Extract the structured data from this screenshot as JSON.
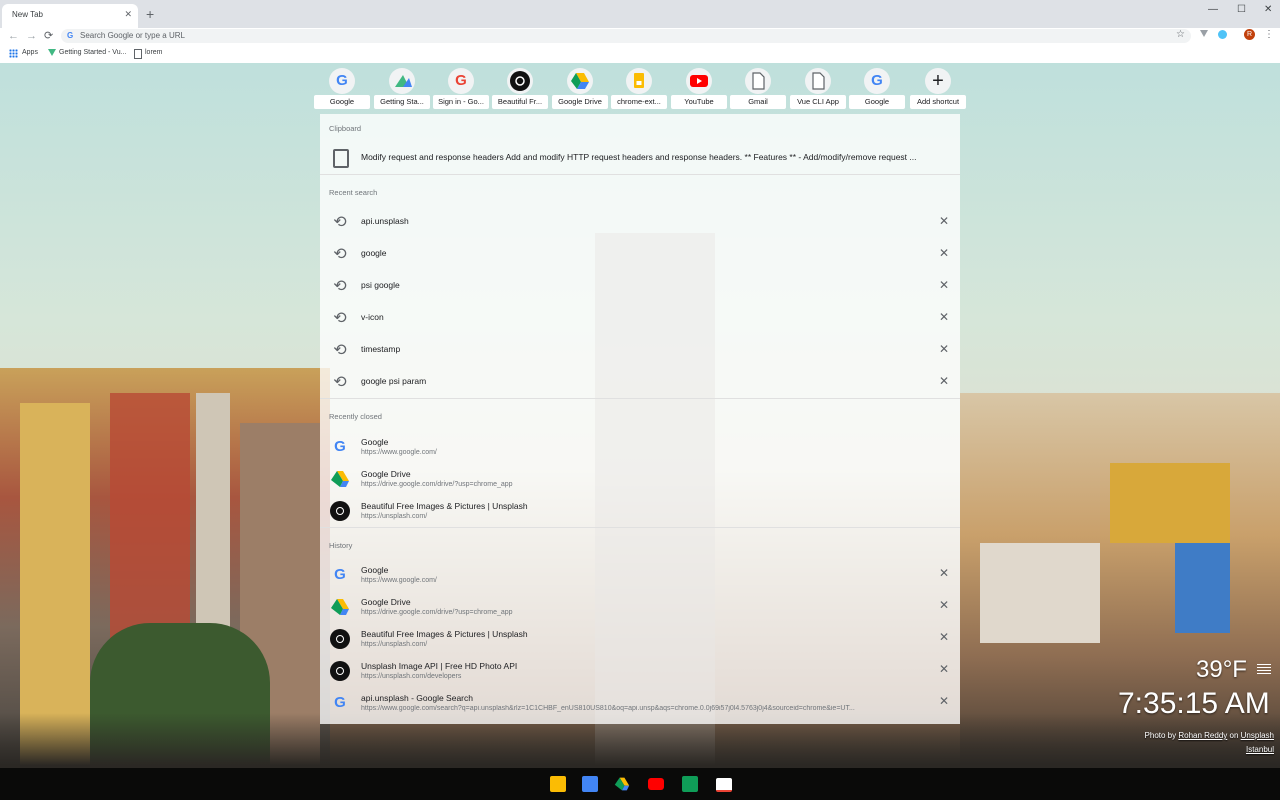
{
  "tab": {
    "title": "New Tab",
    "close": "✕",
    "new_tab": "+"
  },
  "window": {
    "minimize": "—",
    "maximize": "☐",
    "close": "✕"
  },
  "toolbar": {
    "back": "←",
    "forward": "→",
    "reload": "⟳",
    "omnibox_g": "G",
    "omnibox_placeholder": "Search Google or type a URL",
    "bookmark_star": "☆",
    "profile_initial": "R",
    "menu": "⋮"
  },
  "bookmarks": [
    {
      "label": "Apps"
    },
    {
      "label": "Getting Started - Vu..."
    },
    {
      "label": "lorem"
    }
  ],
  "shortcuts": [
    {
      "label": "Google",
      "glyph": "G",
      "color": "#4285f4"
    },
    {
      "label": "Getting Sta...",
      "glyph": "",
      "color": "#41b883"
    },
    {
      "label": "Sign in - Go...",
      "glyph": "G",
      "color": "#ea4335"
    },
    {
      "label": "Beautiful Fr...",
      "glyph": "◉",
      "color": "#111111"
    },
    {
      "label": "Google Drive",
      "glyph": "▲",
      "color": "#0f9d58"
    },
    {
      "label": "chrome-ext...",
      "glyph": "▮",
      "color": "#f4b400"
    },
    {
      "label": "YouTube",
      "glyph": "▶",
      "color": "#ff0000"
    },
    {
      "label": "Gmail",
      "glyph": "▯",
      "color": "#5f6368"
    },
    {
      "label": "Vue CLI App",
      "glyph": "▯",
      "color": "#5f6368"
    },
    {
      "label": "Google",
      "glyph": "G",
      "color": "#4285f4"
    },
    {
      "label": "Add shortcut",
      "glyph": "+",
      "color": "#202124"
    }
  ],
  "dropdown": {
    "clipboard": {
      "title": "Clipboard",
      "text": "Modify request and response headers Add and modify HTTP request headers and response headers. ** Features ** - Add/modify/remove request ..."
    },
    "recent_search": {
      "title": "Recent search",
      "items": [
        "api.unsplash",
        "google",
        "psi google",
        "v-icon",
        "timestamp",
        "google psi param"
      ]
    },
    "recently_closed": {
      "title": "Recently closed",
      "items": [
        {
          "title": "Google",
          "url": "https://www.google.com/",
          "icon": "google-icon"
        },
        {
          "title": "Google Drive",
          "url": "https://drive.google.com/drive/?usp=chrome_app",
          "icon": "drive-icon"
        },
        {
          "title": "Beautiful Free Images & Pictures | Unsplash",
          "url": "https://unsplash.com/",
          "icon": "camera-icon"
        }
      ]
    },
    "history": {
      "title": "History",
      "items": [
        {
          "title": "Google",
          "url": "https://www.google.com/",
          "icon": "google-icon"
        },
        {
          "title": "Google Drive",
          "url": "https://drive.google.com/drive/?usp=chrome_app",
          "icon": "drive-icon"
        },
        {
          "title": "Beautiful Free Images & Pictures | Unsplash",
          "url": "https://unsplash.com/",
          "icon": "camera-icon"
        },
        {
          "title": "Unsplash Image API | Free HD Photo API",
          "url": "https://unsplash.com/developers",
          "icon": "camera-icon"
        },
        {
          "title": "api.unsplash - Google Search",
          "url": "https://www.google.com/search?q=api.unsplash&rlz=1C1CHBF_enUS810US810&oq=api.unsp&aqs=chrome.0.0j69i57j0l4.5763j0j4&sourceid=chrome&ie=UT...",
          "icon": "google-icon"
        }
      ]
    },
    "remove_glyph": "✕"
  },
  "weather": {
    "temperature": "39°F",
    "icon": "fog-icon"
  },
  "clock": {
    "time": "7:35:15 AM"
  },
  "credit": {
    "prefix": "Photo by",
    "author": "Rohan Reddy",
    "on": "on",
    "site": "Unsplash",
    "location": "Istanbul"
  },
  "dock": [
    {
      "name": "keep",
      "color": "#fbbc04"
    },
    {
      "name": "docs",
      "color": "#4285f4"
    },
    {
      "name": "drive",
      "color": "#0f9d58"
    },
    {
      "name": "youtube",
      "color": "#ff0000"
    },
    {
      "name": "sheets",
      "color": "#0f9d58"
    },
    {
      "name": "gmail",
      "color": "#ea4335"
    }
  ]
}
